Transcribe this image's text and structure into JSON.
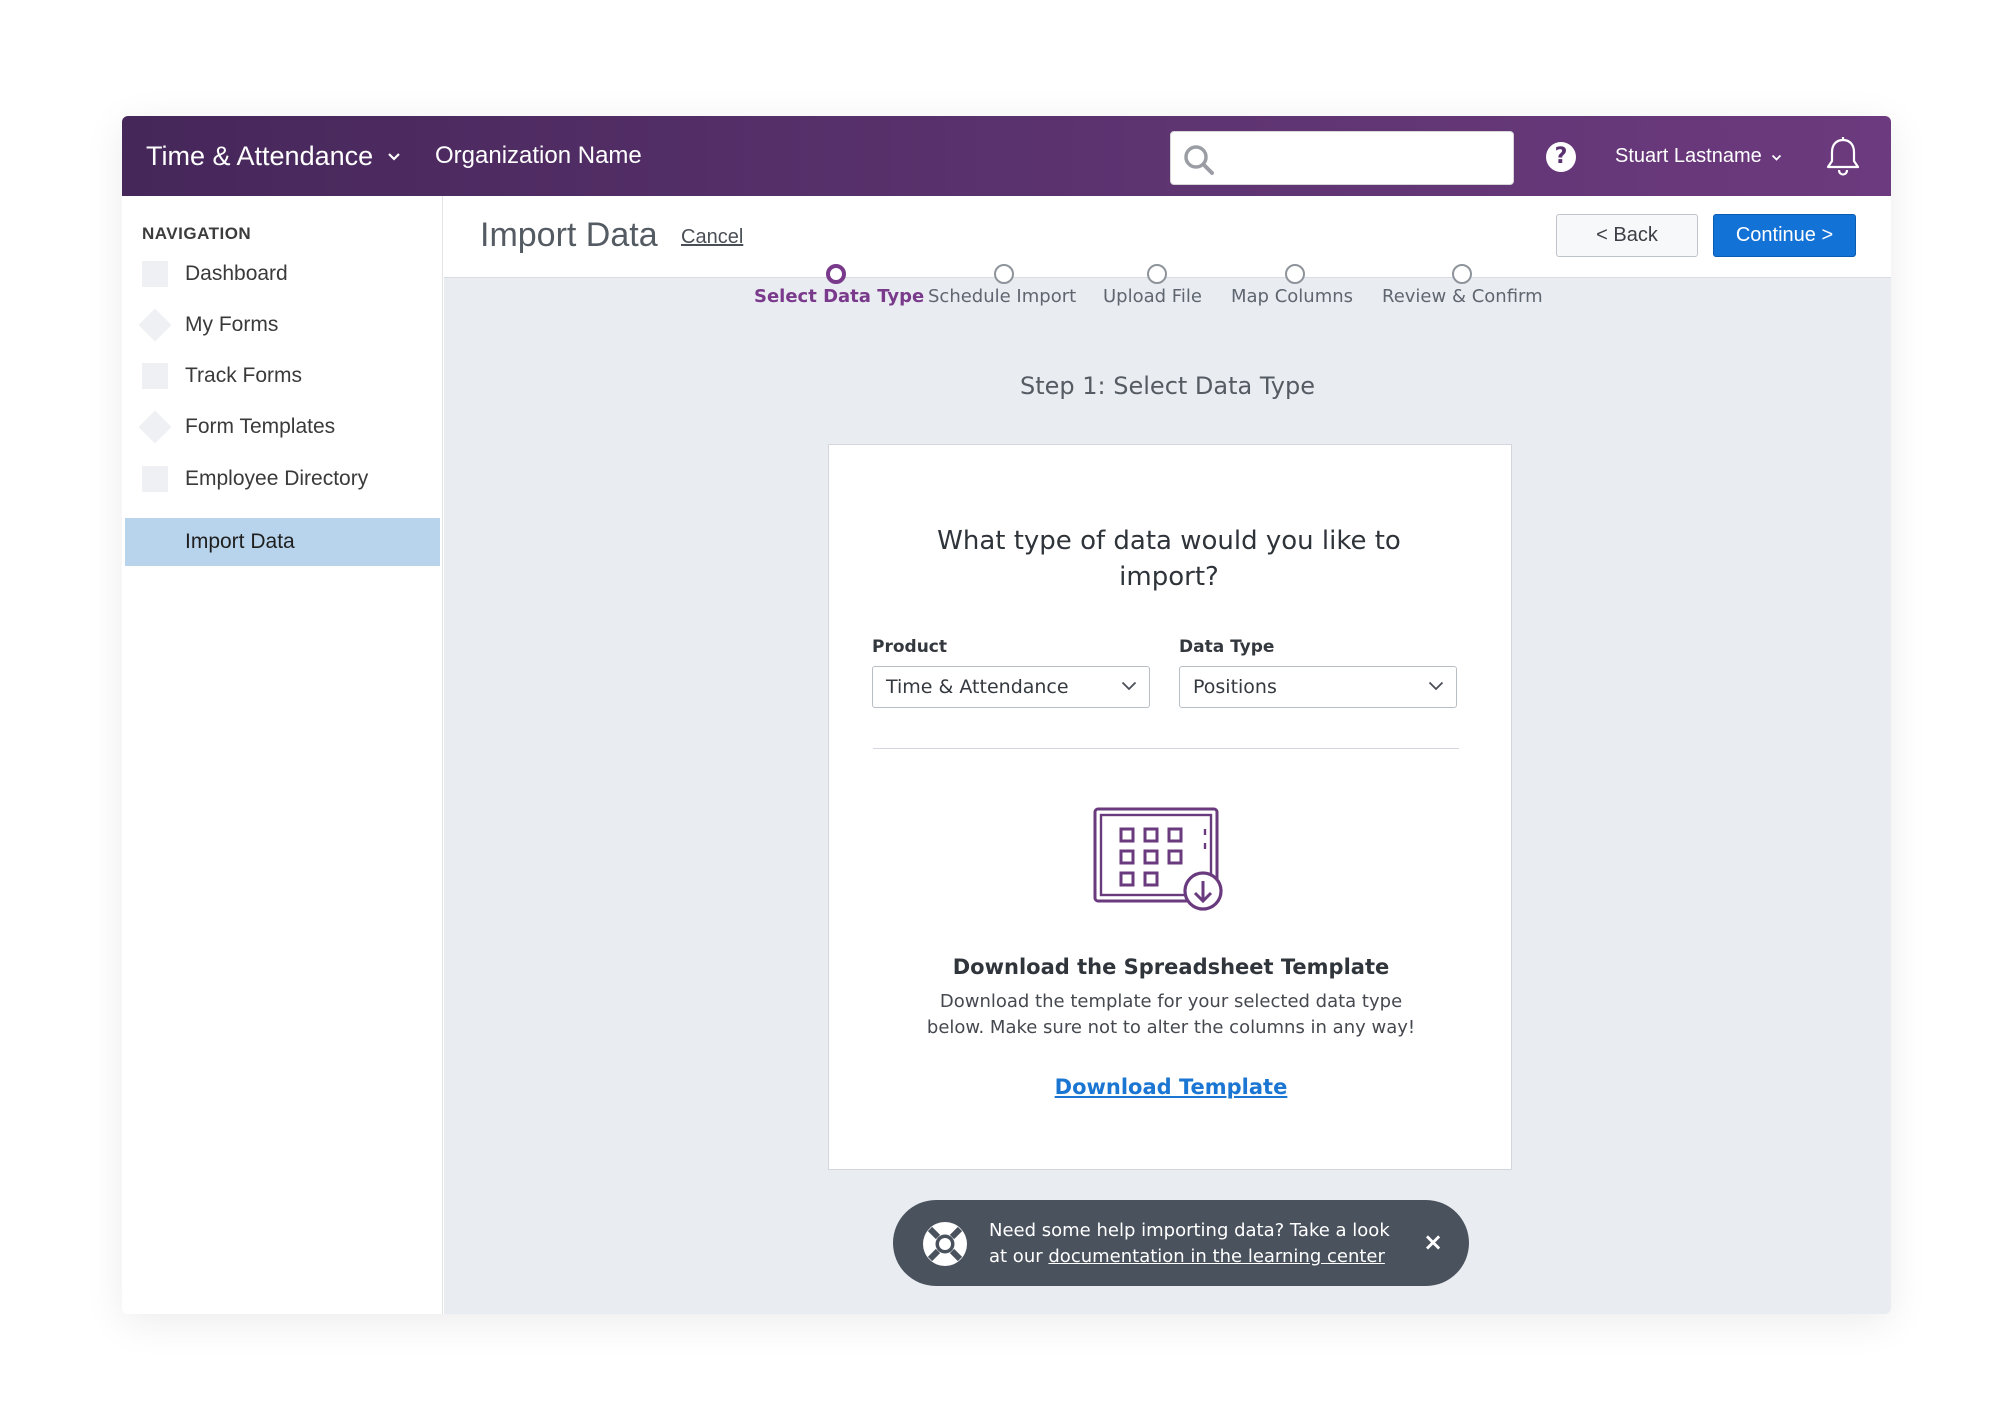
{
  "header": {
    "product": "Time & Attendance",
    "organization": "Organization Name",
    "search_placeholder": "",
    "user_name": "Stuart Lastname"
  },
  "sidebar": {
    "heading": "NAVIGATION",
    "items": [
      {
        "label": "Dashboard",
        "icon": "square-icon"
      },
      {
        "label": "My Forms",
        "icon": "diamond-icon"
      },
      {
        "label": "Track Forms",
        "icon": "square-icon"
      },
      {
        "label": "Form Templates",
        "icon": "diamond-icon"
      },
      {
        "label": "Employee Directory",
        "icon": "square-icon"
      },
      {
        "label": "Import Data",
        "active": true
      }
    ]
  },
  "page": {
    "title": "Import Data",
    "cancel_label": "Cancel",
    "back_label": "< Back",
    "continue_label": "Continue >"
  },
  "stepper": {
    "steps": [
      {
        "label": "Select Data Type",
        "active": true
      },
      {
        "label": "Schedule Import"
      },
      {
        "label": "Upload File"
      },
      {
        "label": "Map Columns"
      },
      {
        "label": "Review & Confirm"
      }
    ]
  },
  "step_heading": "Step 1: Select Data Type",
  "card": {
    "question": "What type of data would you like to import?",
    "product_label": "Product",
    "product_value": "Time & Attendance",
    "data_type_label": "Data Type",
    "data_type_value": "Positions",
    "download_title": "Download the Spreadsheet Template",
    "download_desc": "Download the template for your selected data type below. Make sure not to alter the columns in any way!",
    "download_link": "Download Template"
  },
  "toast": {
    "text": "Need some help importing data? Take a look at our",
    "link": "documentation in the learning center",
    "close": "×"
  },
  "colors": {
    "header_gradient_start": "#46275a",
    "header_gradient_end": "#6c3a7e",
    "accent_purple": "#7a3a8c",
    "primary_blue": "#1372d6",
    "active_nav_bg": "#b8d4ec",
    "main_bg": "#e9ecf1",
    "toast_bg": "#4a525d"
  }
}
